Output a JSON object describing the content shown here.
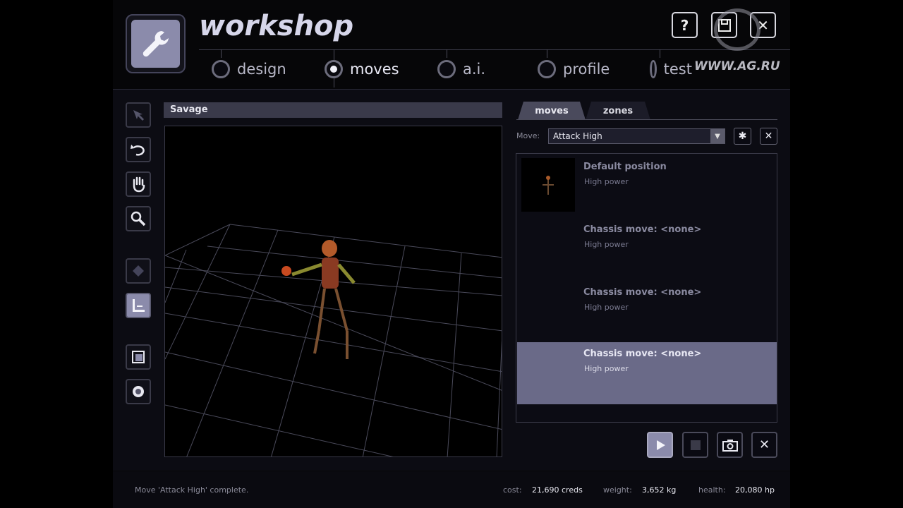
{
  "window": {
    "title": "workshop"
  },
  "nav_tabs": [
    {
      "label": "design",
      "selected": false
    },
    {
      "label": "moves",
      "selected": true
    },
    {
      "label": "a.i.",
      "selected": false
    },
    {
      "label": "profile",
      "selected": false
    },
    {
      "label": "test",
      "selected": false
    }
  ],
  "header_buttons": {
    "help": "?",
    "save_icon": "save-icon",
    "close": "✕"
  },
  "watermark": "WWW.AG.RU",
  "toolbar": [
    "pointer-icon",
    "undo-rotate-icon",
    "hand-pan-icon",
    "zoom-icon",
    "diamond-icon",
    "axis-icon",
    "cube-icon",
    "sphere-icon"
  ],
  "viewport": {
    "title": "Savage"
  },
  "right_tabs": [
    {
      "label": "moves",
      "selected": true
    },
    {
      "label": "zones",
      "selected": false
    }
  ],
  "move_select": {
    "label": "Move:",
    "value": "Attack High"
  },
  "moves_list": [
    {
      "name": "Default position",
      "power": "High power",
      "selected": false
    },
    {
      "name": "Chassis move: <none>",
      "power": "High power",
      "selected": false
    },
    {
      "name": "Chassis move: <none>",
      "power": "High power",
      "selected": false
    },
    {
      "name": "Chassis move: <none>",
      "power": "High power",
      "selected": true
    }
  ],
  "status": {
    "message": "Move 'Attack High' complete.",
    "cost_label": "cost:",
    "cost_value": "21,690 creds",
    "weight_label": "weight:",
    "weight_value": "3,652 kg",
    "health_label": "health:",
    "health_value": "20,080 hp"
  },
  "colors": {
    "accent": "#8b8bab",
    "selected_row": "#6a6a88",
    "background": "#050507"
  }
}
